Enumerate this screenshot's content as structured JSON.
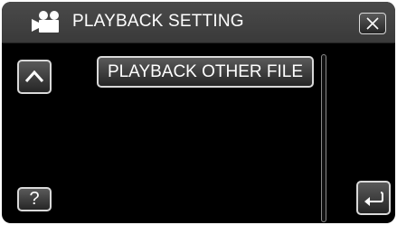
{
  "header": {
    "title": "PLAYBACK SETTING",
    "mode_icon": "video-camera-icon",
    "close_icon": "close-x-icon"
  },
  "menu": {
    "items": [
      {
        "label": "PLAYBACK OTHER FILE"
      }
    ]
  },
  "controls": {
    "scroll_up_icon": "chevron-up-icon",
    "help_label": "?",
    "back_icon": "return-arrow-icon"
  },
  "colors": {
    "screen_bg": "#000000",
    "header_bg": "#424242",
    "button_border": "#d9d9d9",
    "text": "#ffffff"
  }
}
